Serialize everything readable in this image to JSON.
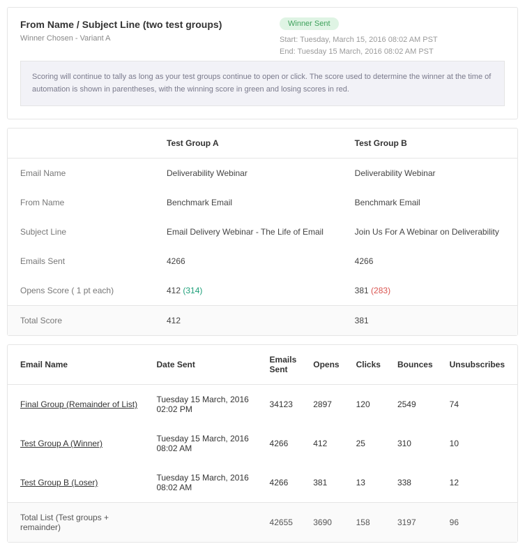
{
  "header": {
    "title": "From Name / Subject Line (two test groups)",
    "subtitle": "Winner Chosen - Variant A",
    "badge": "Winner Sent",
    "start": "Start: Tuesday, March 15, 2016 08:02 AM PST",
    "end": "End: Tuesday 15 March, 2016 08:02 AM PST"
  },
  "info": "Scoring will continue to tally as long as your test groups continue to open or click. The score used to determine the winner at the time of automation is shown in parentheses, with the winning score in green and losing scores in red.",
  "compare": {
    "colA": "Test Group A",
    "colB": "Test Group B",
    "rows": {
      "email_name": {
        "label": "Email Name",
        "a": "Deliverability Webinar",
        "b": "Deliverability Webinar"
      },
      "from_name": {
        "label": "From Name",
        "a": "Benchmark Email",
        "b": "Benchmark Email"
      },
      "subject": {
        "label": "Subject Line",
        "a": "Email Delivery Webinar - The Life of Email",
        "b": "Join Us For A Webinar on Deliverability"
      },
      "sent": {
        "label": "Emails Sent",
        "a": "4266",
        "b": "4266"
      },
      "opens": {
        "label": "Opens Score ( 1 pt each)",
        "a": "412",
        "a_paren": "(314)",
        "b": "381",
        "b_paren": "(283)"
      }
    },
    "total": {
      "label": "Total Score",
      "a": "412",
      "b": "381"
    }
  },
  "results": {
    "cols": {
      "name": "Email Name",
      "date": "Date Sent",
      "sent": "Emails Sent",
      "opens": "Opens",
      "clicks": "Clicks",
      "bounces": "Bounces",
      "unsub": "Unsubscribes"
    },
    "rows": [
      {
        "name": "Final Group (Remainder of List)",
        "date": "Tuesday 15 March, 2016 02:02 PM",
        "sent": "34123",
        "opens": "2897",
        "clicks": "120",
        "bounces": "2549",
        "unsub": "74"
      },
      {
        "name": "Test Group A (Winner)",
        "date": "Tuesday 15 March, 2016 08:02 AM",
        "sent": "4266",
        "opens": "412",
        "clicks": "25",
        "bounces": "310",
        "unsub": "10"
      },
      {
        "name": "Test Group B (Loser)",
        "date": "Tuesday 15 March, 2016 08:02 AM",
        "sent": "4266",
        "opens": "381",
        "clicks": "13",
        "bounces": "338",
        "unsub": "12"
      }
    ],
    "total": {
      "label": "Total List (Test groups + remainder)",
      "sent": "42655",
      "opens": "3690",
      "clicks": "158",
      "bounces": "3197",
      "unsub": "96"
    }
  }
}
